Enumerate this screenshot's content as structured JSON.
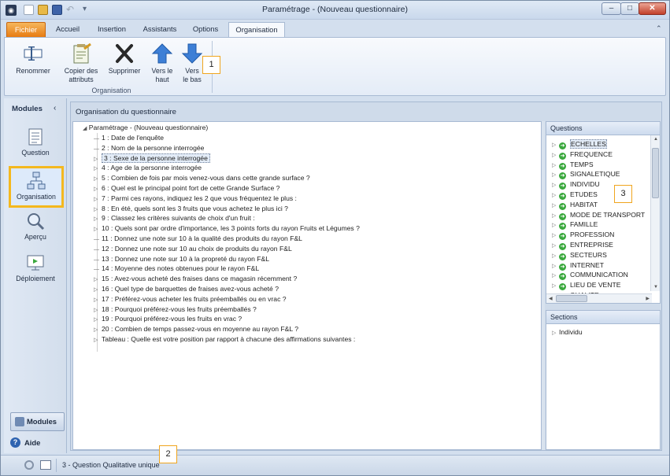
{
  "window": {
    "title": "Paramétrage - (Nouveau questionnaire)"
  },
  "tabs": [
    "Fichier",
    "Accueil",
    "Insertion",
    "Assistants",
    "Options",
    "Organisation"
  ],
  "ribbon": {
    "buttons": {
      "rename": "Renommer",
      "copy_line1": "Copier des",
      "copy_line2": "attributs",
      "delete": "Supprimer",
      "up_line1": "Vers le",
      "up_line2": "haut",
      "down_line1": "Vers",
      "down_line2": "le bas"
    },
    "group": "Organisation"
  },
  "callouts": {
    "c1": "1",
    "c2": "2",
    "c3": "3"
  },
  "modules": {
    "title": "Modules",
    "collapse": "‹",
    "items": [
      "Question",
      "Organisation",
      "Aperçu",
      "Déploiement"
    ],
    "modules_button": "Modules",
    "help": "Aide"
  },
  "main": {
    "title": "Organisation du questionnaire",
    "root": "Paramétrage - (Nouveau questionnaire)",
    "rows": [
      "1 : Date de l'enquête",
      "2 : Nom de la personne interrogée",
      "3 : Sexe de la personne interrogée",
      "4 : Age de la personne interrogée",
      "5 : Combien de fois par mois venez-vous dans cette grande surface ?",
      "6 : Quel est le principal point fort de cette Grande Surface ?",
      "7 : Parmi ces rayons, indiquez les 2 que vous fréquentez le plus :",
      "8 : En été, quels sont les 3 fruits que vous achetez le plus ici ?",
      "9 : Classez les critères suivants de choix d'un fruit :",
      "10 : Quels sont par ordre d'importance, les 3 points forts du rayon Fruits et Légumes ?",
      "11 : Donnez une note sur 10 à la qualité des produits du rayon F&L",
      "12 : Donnez une note sur 10 au choix de produits du rayon F&L",
      "13 : Donnez une note sur 10 à la propreté du rayon F&L",
      "14 : Moyenne des notes obtenues pour le rayon F&L",
      "15 : Avez-vous acheté des fraises dans ce magasin récemment ?",
      "16 : Quel type de barquettes de fraises avez-vous acheté ?",
      "17 : Préférez-vous acheter les fruits préemballés ou en vrac ?",
      "18 : Pourquoi préférez-vous les fruits préemballés ?",
      "19 : Pourquoi préférez-vous les fruits en vrac ?",
      "20 : Combien de temps passez-vous en moyenne au rayon F&L ?",
      "Tableau : Quelle est votre position par rapport à chacune des affirmations suivantes :"
    ],
    "expandable": [
      false,
      false,
      true,
      true,
      true,
      true,
      true,
      true,
      true,
      true,
      false,
      false,
      false,
      false,
      true,
      true,
      true,
      true,
      true,
      true,
      true
    ],
    "selected_index": 2
  },
  "questions_panel": {
    "title": "Questions",
    "items": [
      "ECHELLES",
      "FREQUENCE",
      "TEMPS",
      "SIGNALETIQUE",
      "INDIVIDU",
      "ETUDES",
      "HABITAT",
      "MODE DE TRANSPORT",
      "FAMILLE",
      "PROFESSION",
      "ENTREPRISE",
      "SECTEURS",
      "INTERNET",
      "COMMUNICATION",
      "LIEU DE VENTE",
      "QUALITE"
    ]
  },
  "sections_panel": {
    "title": "Sections",
    "items": [
      "Individu"
    ]
  },
  "status": {
    "text": "3 - Question Qualitative  unique"
  },
  "colors": {
    "accent": "#f4b81e",
    "fichier_tab": "#e77b12",
    "frame": "#d3dfee"
  }
}
